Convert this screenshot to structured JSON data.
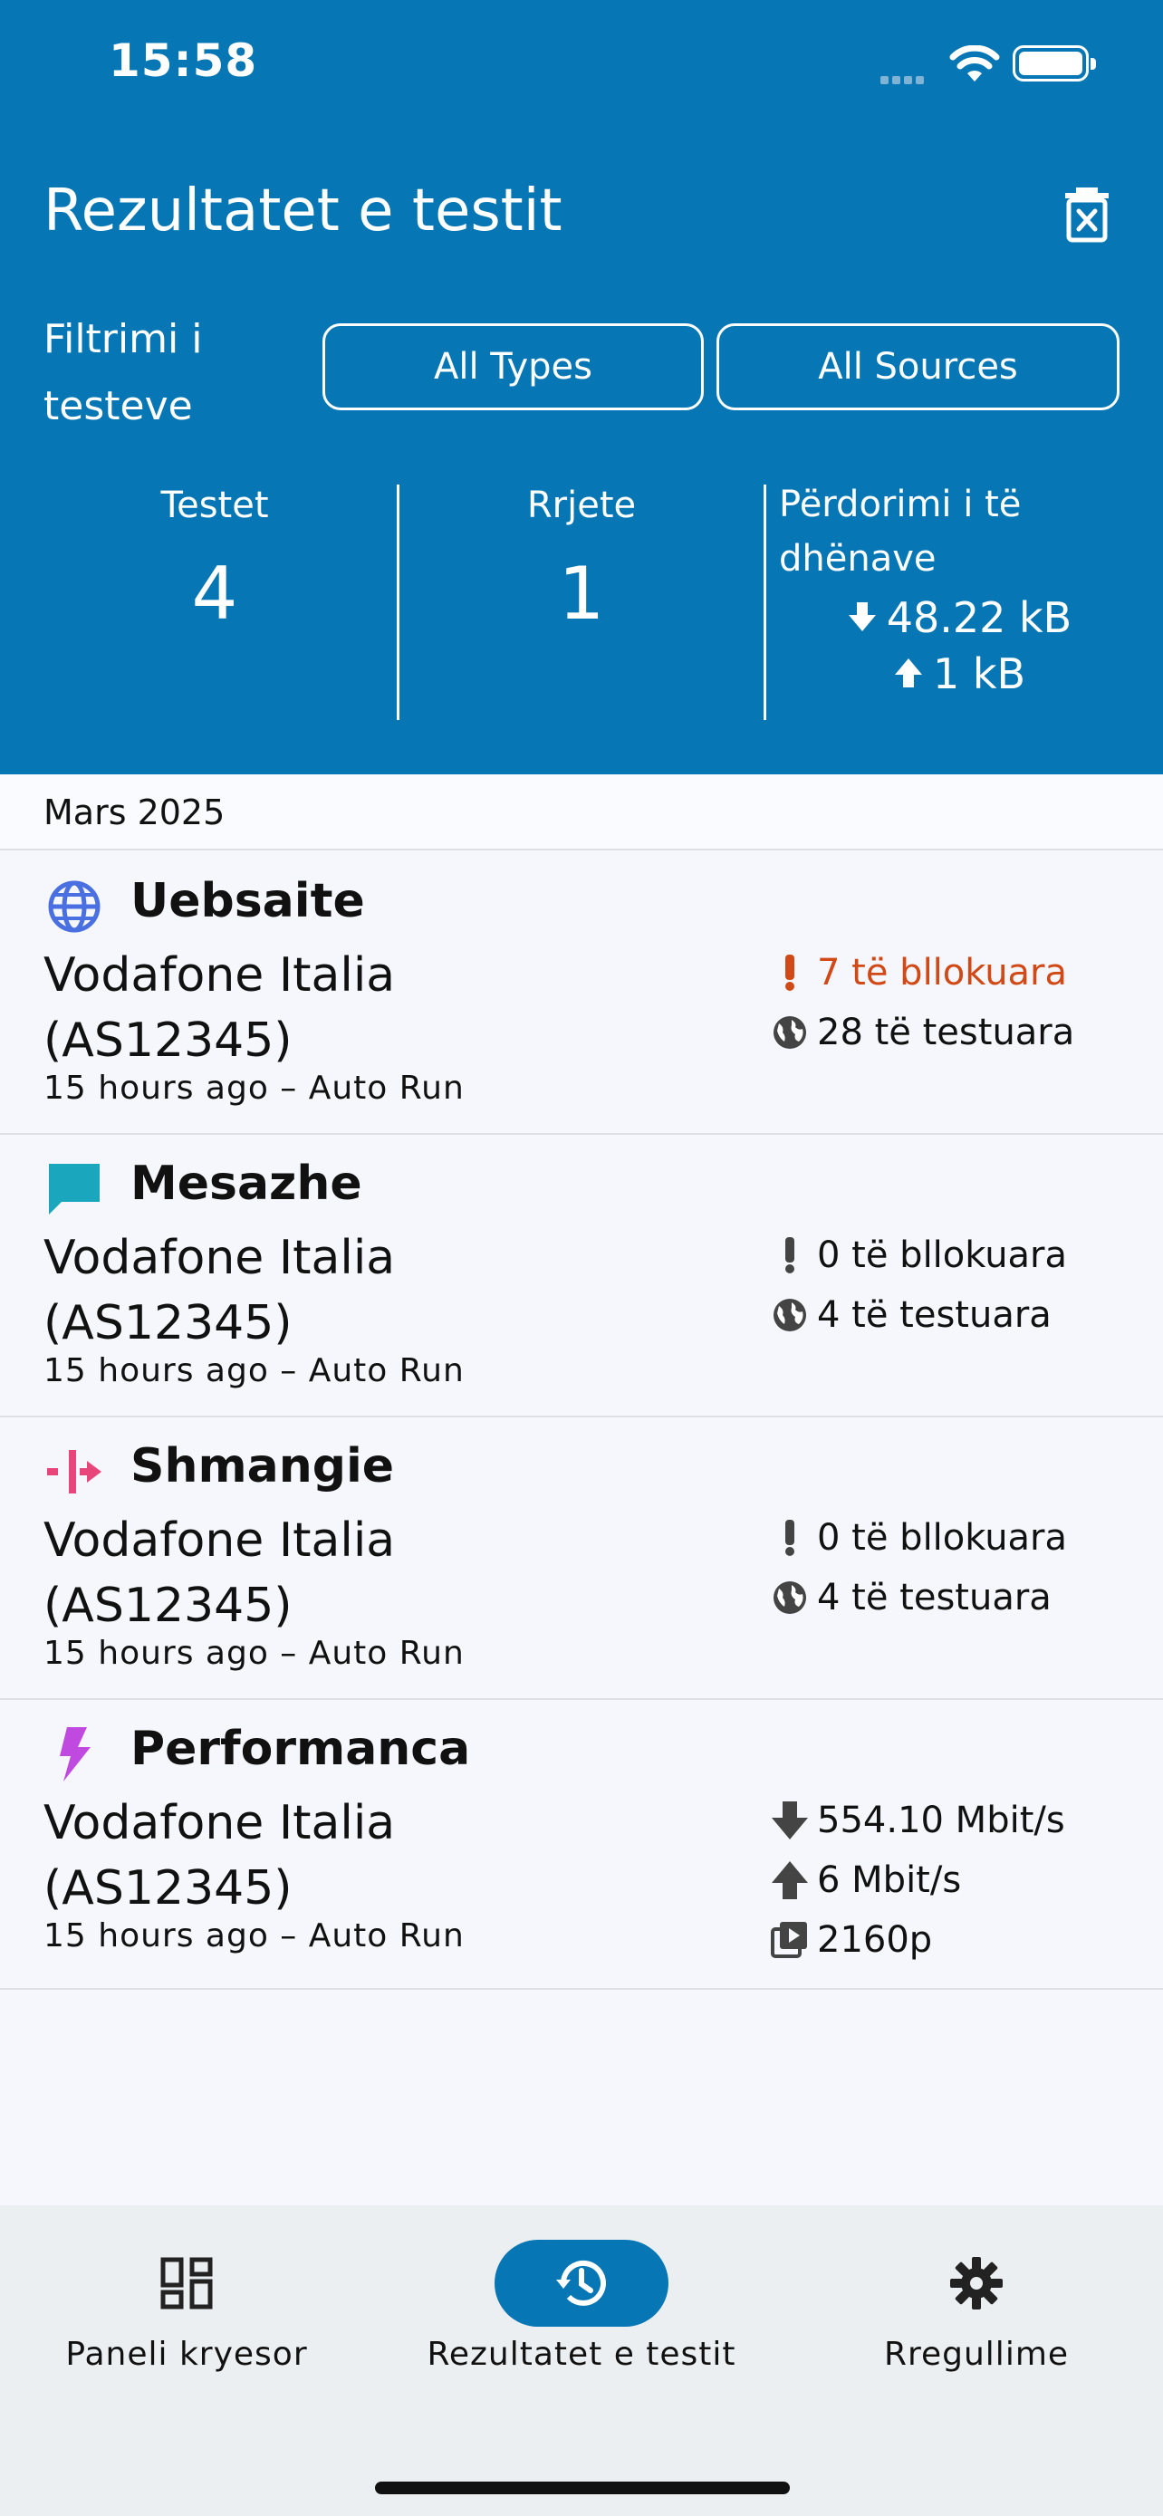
{
  "status_bar": {
    "time": "15:58"
  },
  "header": {
    "title": "Rezultatet e testit",
    "filter_label": "Filtrimi i testeve",
    "filter_types": "All Types",
    "filter_sources": "All Sources",
    "stats": {
      "tests_label": "Testet",
      "tests_value": "4",
      "networks_label": "Rrjete",
      "networks_value": "1",
      "usage_label": "Përdorimi i të dhënave",
      "download": "48.22 kB",
      "upload": "1 kB"
    }
  },
  "list": {
    "month": "Mars 2025",
    "rows": [
      {
        "title": "Uebsaite",
        "network": "Vodafone Italia (AS12345)",
        "meta": "15 hours ago – Auto Run",
        "blocked": "7 të bllokuara",
        "tested": "28 të testuara"
      },
      {
        "title": "Mesazhe",
        "network": "Vodafone Italia (AS12345)",
        "meta": "15 hours ago – Auto Run",
        "blocked": "0 të bllokuara",
        "tested": "4 të testuara"
      },
      {
        "title": "Shmangie",
        "network": "Vodafone Italia (AS12345)",
        "meta": "15 hours ago – Auto Run",
        "blocked": "0 të bllokuara",
        "tested": "4 të testuara"
      },
      {
        "title": "Performanca",
        "network": "Vodafone Italia (AS12345)",
        "meta": "15 hours ago – Auto Run",
        "download": "554.10 Mbit/s",
        "upload": "6 Mbit/s",
        "video": "2160p"
      }
    ]
  },
  "nav": {
    "home": "Paneli kryesor",
    "results": "Rezultatet e testit",
    "settings": "Rregullime"
  },
  "colors": {
    "header_bg": "#0677b4",
    "blocked_red": "#d04916",
    "websites_icon": "#4a6fe0",
    "messaging_icon": "#1aa7bd",
    "circumvention_icon": "#e8457a",
    "performance_icon": "#c04ae0"
  },
  "icons": [
    "trash-icon",
    "globe-icon",
    "chat-icon",
    "circumvention-icon",
    "bolt-icon",
    "exclamation-icon",
    "world-icon",
    "arrow-down-icon",
    "arrow-up-icon",
    "video-icon",
    "dashboard-icon",
    "history-icon",
    "gear-icon"
  ]
}
